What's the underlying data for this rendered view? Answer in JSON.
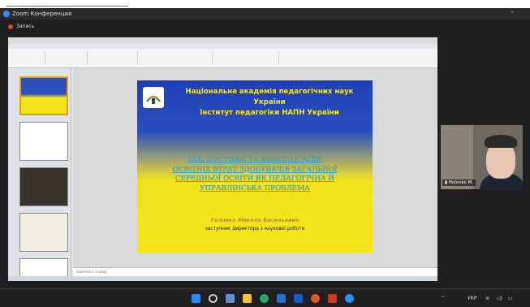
{
  "app": {
    "title": "Zoom Конференция",
    "record_label": "Запись",
    "minimize_glyph": "–"
  },
  "powerpoint": {
    "notes_placeholder": "Заметки к слайду"
  },
  "slide": {
    "header_line1": "Національна академія педагогічних наук України",
    "header_line2": "Інститут педагогіки НАПН України",
    "title_lines": [
      "ДІАГНОСТИКИ ТА КОМПЕНСАЦІЯ",
      "ОСВІТНІХ ВТРАТ ЗДОБУВАЧІВ ЗАГАЛЬНОЇ",
      "СЕРЕДНЬОЇ ОСВІТИ ЯК ПЕДАГОГІЧНА Й",
      "УПРАВЛІНСЬКА ПРОБЛЕМА"
    ],
    "author": "Головко Микола Васильович",
    "role": "заступник директора з наукової роботи"
  },
  "participant": {
    "name": "Holovko M."
  },
  "taskbar": {
    "lang": "УКР"
  },
  "colors": {
    "slide_blue": "#1e3fb6",
    "slide_yellow": "#f7e51a",
    "title_cyan": "#3aa6c9",
    "zoom_blue": "#2d8cff"
  }
}
